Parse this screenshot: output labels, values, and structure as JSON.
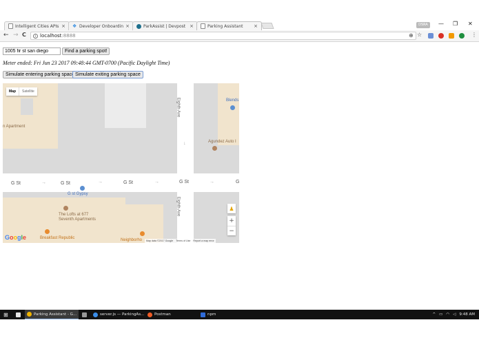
{
  "browser": {
    "tabs": [
      {
        "title": "Intelligent Cities APIs - I",
        "icon": "page-icon"
      },
      {
        "title": "Developer Onboarding",
        "icon": "dropbox-icon"
      },
      {
        "title": "ParkAssist | Devpost",
        "icon": "devpost-icon"
      },
      {
        "title": "Parking Assistant",
        "icon": "page-icon",
        "active": true
      }
    ],
    "tab_close": "×",
    "profile_label": "DSRA",
    "window_controls": {
      "minimize": "—",
      "maximize": "❐",
      "close": "✕"
    },
    "nav": {
      "back": "←",
      "forward": "→",
      "reload": "C"
    },
    "url": {
      "info": "i",
      "host": "localhost",
      "port": ":8888"
    },
    "toolbar_icons": {
      "star": "☆",
      "menu": "⋮"
    }
  },
  "page": {
    "address_input": {
      "value": "1005 fir st san diego"
    },
    "find_button": "Find a parking spot!",
    "meter_status": "Meter ended: Fri Jun 23 2017 09:48:44 GMT-0700 (Pacific Daylight Time)",
    "simulate_enter_button": "Simulate entering parking space",
    "simulate_exit_button": "Simulate exiting parking space"
  },
  "map": {
    "type_control": {
      "map": "Map",
      "satellite": "Satellite"
    },
    "streets": {
      "g_st": [
        "G St",
        "G St",
        "G St",
        "G St",
        "G"
      ],
      "eighth_ave_north": "Eighth Ave",
      "eighth_ave_south": "Eighth Ave",
      "arrows": [
        "→",
        "→",
        "→",
        "→",
        "↓"
      ]
    },
    "places": {
      "apartment": "n Apartment",
      "blends": "Blends",
      "agundez": "Agundez Auto I",
      "gypsy": "G st Gypsy",
      "lofts_line1": "The Lofts at 677",
      "lofts_line2": "Seventh Apartments",
      "breakfast": "Breakfast Republic",
      "neighborhood": "Neighborho"
    },
    "google_logo": [
      "G",
      "o",
      "o",
      "g",
      "l",
      "e"
    ],
    "google_colors": [
      "#4285f4",
      "#ea4335",
      "#fbbc05",
      "#4285f4",
      "#34a853",
      "#ea4335"
    ],
    "zoom": {
      "in": "+",
      "out": "−"
    },
    "pegman": "♟",
    "attribution": [
      "Map data ©2017 Google",
      "Terms of Use",
      "Report a map error"
    ],
    "colors": {
      "road": "#ffffff",
      "block": "#dadada",
      "building": "#e8e8e8",
      "residential": "#f1e4cd",
      "poi_brown": "#b08460",
      "poi_blue": "#5b8fd1",
      "poi_orange": "#e88b2e"
    }
  },
  "taskbar": {
    "items": [
      {
        "label": "Parking Assistant - G...",
        "icon": "chrome-icon",
        "color": "#f0b400",
        "active": true
      },
      {
        "label": "",
        "icon": "terminal-icon",
        "color": "#999999"
      },
      {
        "label": "server.js — ParkingAs...",
        "icon": "vscode-icon",
        "color": "#3b8eea"
      },
      {
        "label": "Postman",
        "icon": "postman-icon",
        "color": "#ef5b25"
      },
      {
        "label": "npm",
        "icon": "cmd-icon",
        "color": "#2f6bd8"
      }
    ],
    "tray_arrow": "^",
    "clock": "9:48 AM"
  }
}
